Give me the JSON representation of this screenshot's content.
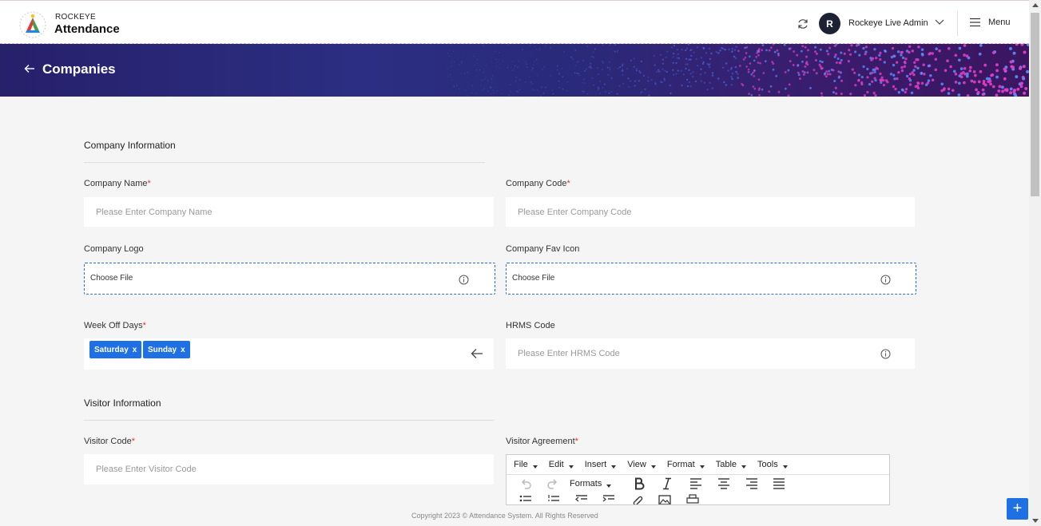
{
  "header": {
    "brand_top": "ROCKEYE",
    "brand_main": "Attendance",
    "user_initial": "R",
    "user_name": "Rockeye Live Admin",
    "menu_label": "Menu"
  },
  "banner": {
    "title": "Companies"
  },
  "company_section": {
    "title": "Company Information",
    "company_name": {
      "label": "Company Name",
      "required": "*",
      "placeholder": "Please Enter Company Name"
    },
    "company_code": {
      "label": "Company Code",
      "required": "*",
      "placeholder": "Please Enter Company Code"
    },
    "company_logo": {
      "label": "Company Logo",
      "button": "Choose File"
    },
    "company_fav_icon": {
      "label": "Company Fav Icon",
      "button": "Choose File"
    },
    "week_off_days": {
      "label": "Week Off Days",
      "required": "*",
      "tags": [
        "Saturday",
        "Sunday"
      ],
      "remove_glyph": "x"
    },
    "hrms_code": {
      "label": "HRMS Code",
      "placeholder": "Please Enter HRMS Code"
    }
  },
  "visitor_section": {
    "title": "Visitor Information",
    "visitor_code": {
      "label": "Visitor Code",
      "required": "*",
      "placeholder": "Please Enter Visitor Code"
    },
    "visitor_agreement": {
      "label": "Visitor Agreement",
      "required": "*",
      "menus": [
        "File",
        "Edit",
        "Insert",
        "View",
        "Format",
        "Table",
        "Tools"
      ],
      "formats_label": "Formats"
    }
  },
  "footer": {
    "copyright": "Copyright 2023 © Attendance System. All Rights Reserved"
  },
  "fab": {
    "label": "+"
  },
  "colors": {
    "accent": "#1f6fe5",
    "banner_start": "#27206b",
    "banner_end": "#3b1560",
    "required": "#dd3333"
  }
}
